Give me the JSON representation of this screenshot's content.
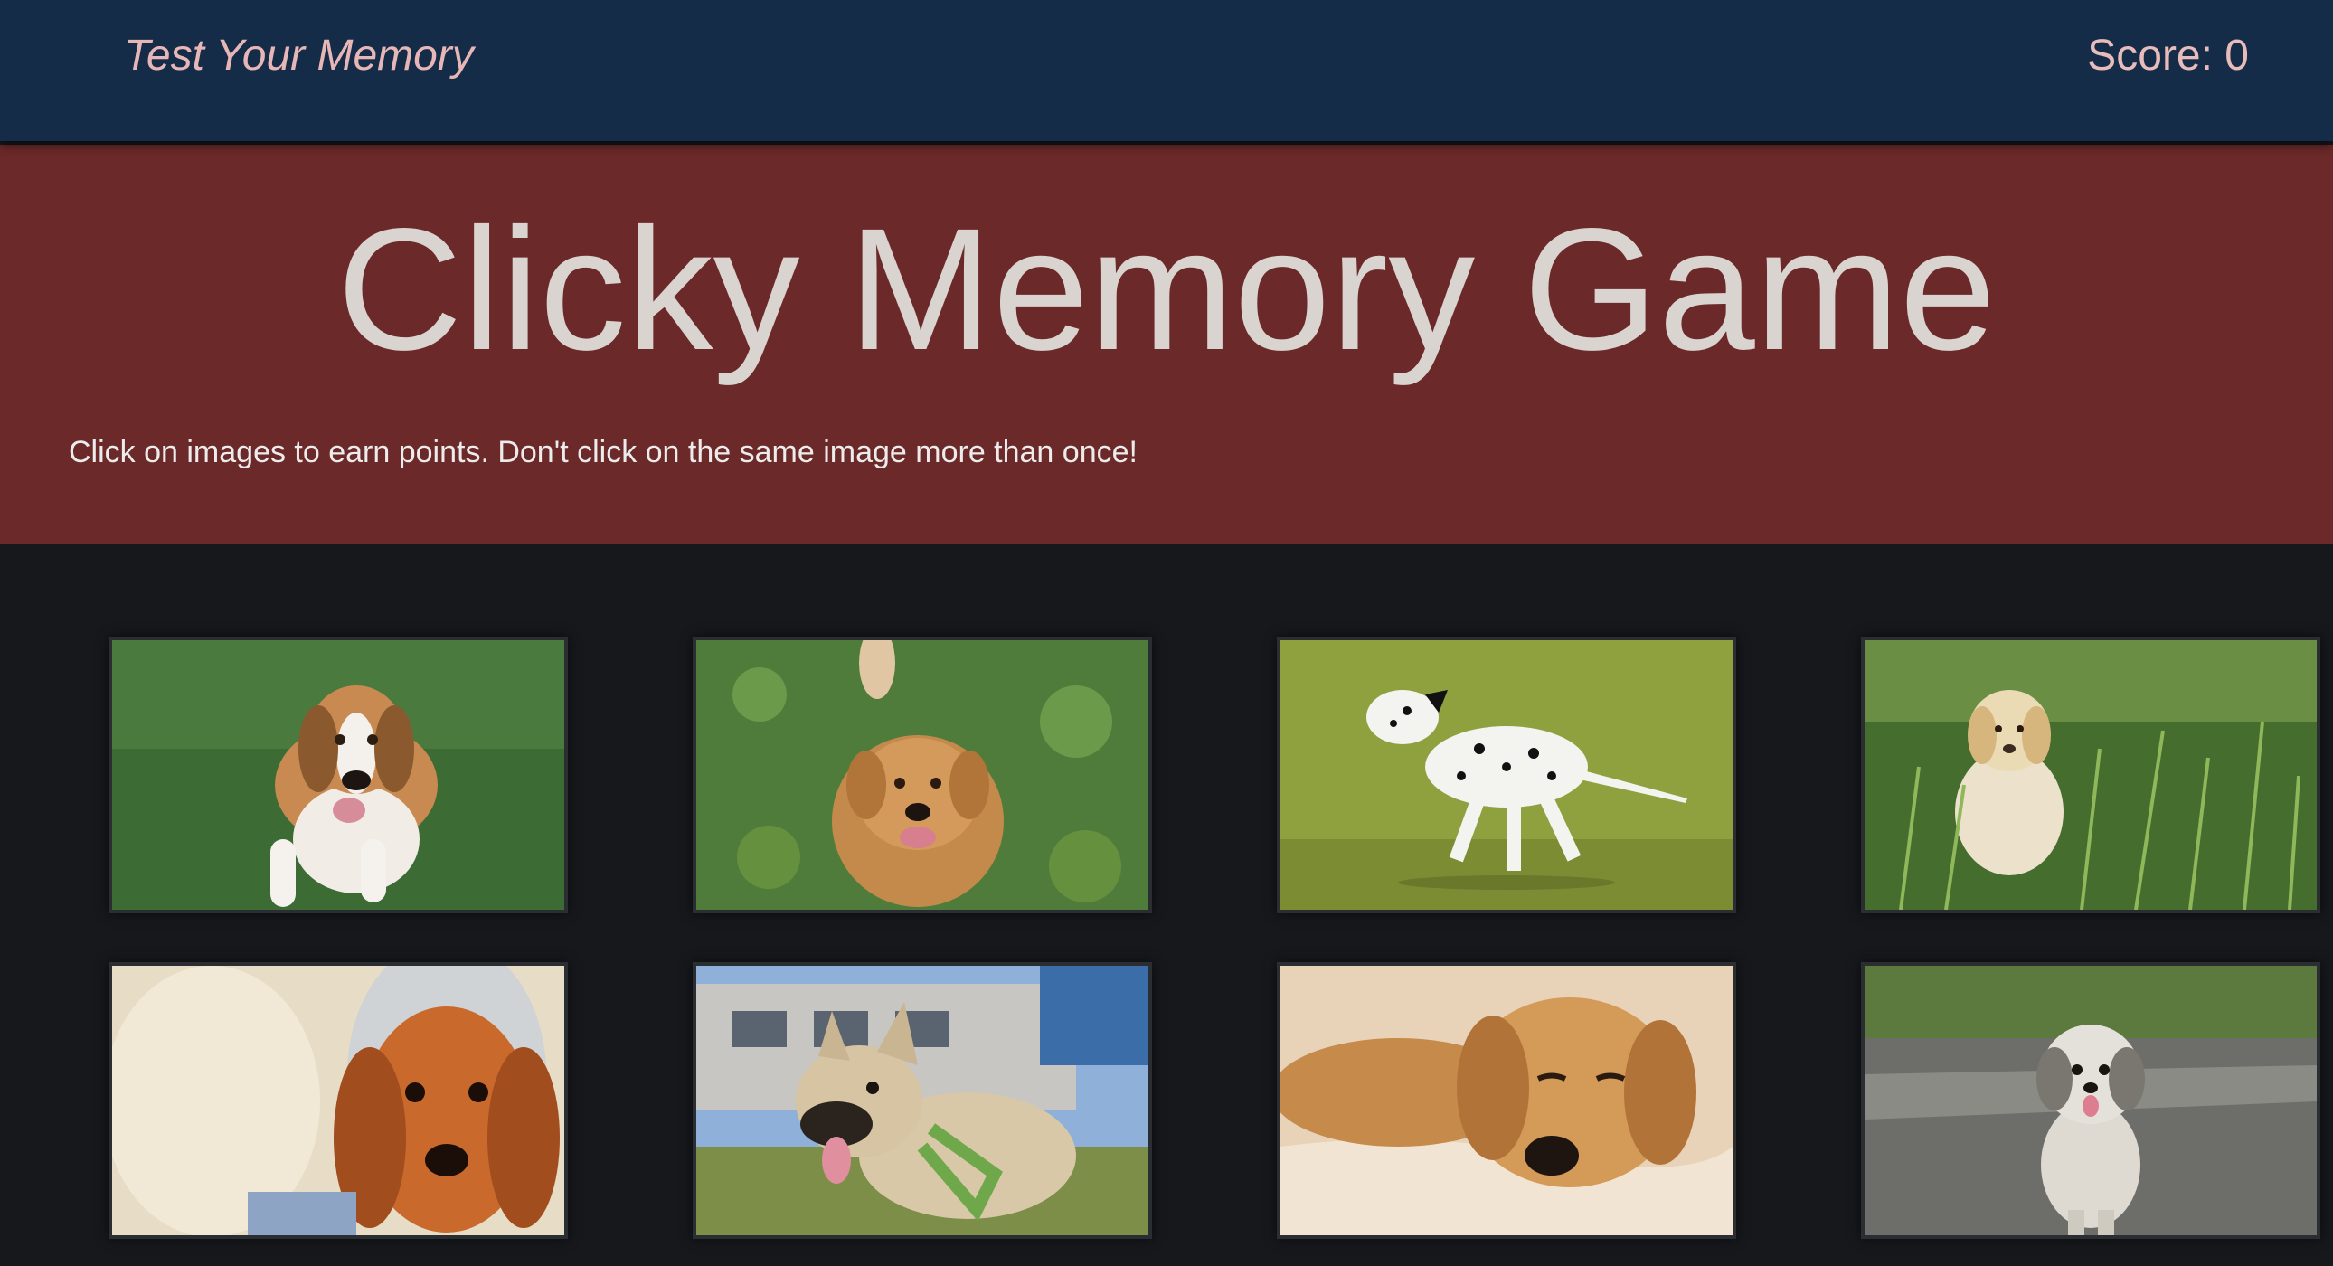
{
  "navbar": {
    "brand": "Test Your Memory",
    "score": "Score: 0"
  },
  "jumbotron": {
    "title": "Clicky Memory Game",
    "subtitle": "Click on images to earn points. Don't click on the same image more than once!"
  },
  "cards": [
    {
      "subject": "beagle-on-grass"
    },
    {
      "subject": "golden-retriever-on-clover"
    },
    {
      "subject": "dalmatian-running"
    },
    {
      "subject": "labrador-puppy-in-tall-grass"
    },
    {
      "subject": "cocker-spaniel-in-hood"
    },
    {
      "subject": "french-bulldog-with-harness"
    },
    {
      "subject": "golden-puppy-sleeping"
    },
    {
      "subject": "shih-tzu-on-road"
    }
  ],
  "colors": {
    "navbar": "#142c48",
    "brand_text": "#e7b7b7",
    "jumbotron": "#6c2929",
    "title_text": "#d9d4cf",
    "page_background": "#16181c"
  }
}
